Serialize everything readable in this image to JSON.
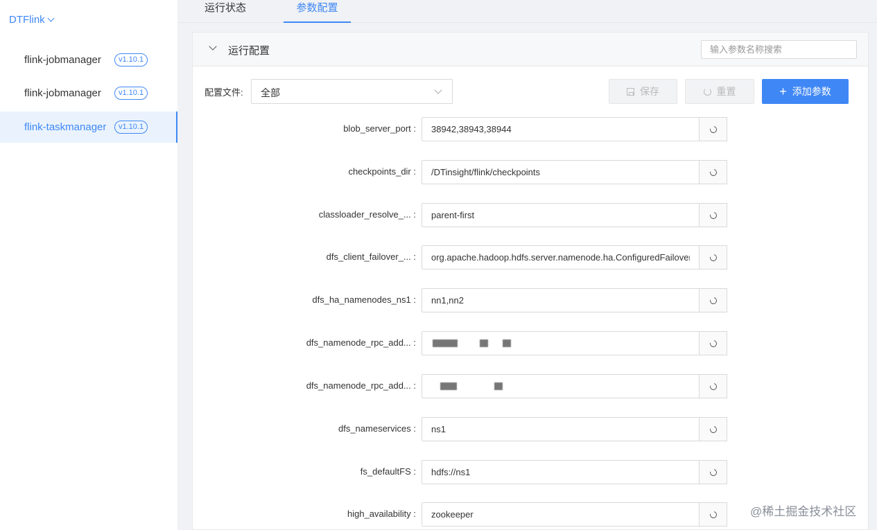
{
  "sidebar": {
    "brand": "DTFlink",
    "items": [
      {
        "label": "flink-jobmanager",
        "version": "v1.10.1"
      },
      {
        "label": "flink-jobmanager",
        "version": "v1.10.1"
      },
      {
        "label": "flink-taskmanager",
        "version": "v1.10.1"
      }
    ]
  },
  "tabs": [
    {
      "label": "运行状态"
    },
    {
      "label": "参数配置"
    }
  ],
  "panel": {
    "title": "运行配置",
    "search_placeholder": "输入参数名称搜索",
    "file_label": "配置文件:",
    "file_value": "全部",
    "save_label": "保存",
    "reset_label": "重置",
    "add_label": "添加参数"
  },
  "params": [
    {
      "key": "blob_server_port",
      "value": "38942,38943,38944"
    },
    {
      "key": "checkpoints_dir",
      "value": "/DTinsight/flink/checkpoints"
    },
    {
      "key": "classloader_resolve_...",
      "value": "parent-first"
    },
    {
      "key": "dfs_client_failover_...",
      "value": "org.apache.hadoop.hdfs.server.namenode.ha.ConfiguredFailoverProxyProvider"
    },
    {
      "key": "dfs_ha_namenodes_ns1",
      "value": "nn1,nn2"
    },
    {
      "key": "dfs_namenode_rpc_add...",
      "value": ""
    },
    {
      "key": "dfs_namenode_rpc_add...",
      "value": ""
    },
    {
      "key": "dfs_nameservices",
      "value": "ns1"
    },
    {
      "key": "fs_defaultFS",
      "value": "hdfs://ns1"
    },
    {
      "key": "high_availability",
      "value": "zookeeper"
    }
  ],
  "watermark": "@稀土掘金技术社区",
  "colors": {
    "accent": "#3f87f5",
    "active_bg": "#eaf3fd"
  }
}
